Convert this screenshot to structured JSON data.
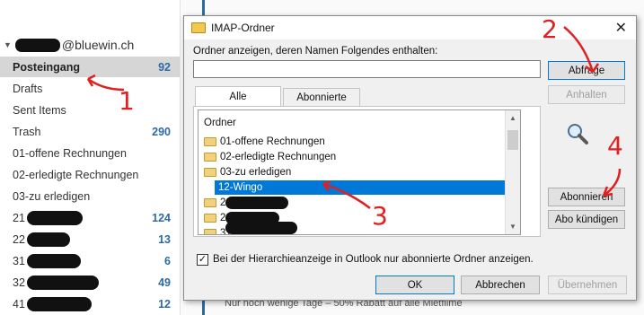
{
  "folder_pane": {
    "account_suffix": "@bluewin.ch",
    "folders": [
      {
        "label": "Posteingang",
        "count": "92",
        "selected": true
      },
      {
        "label": "Drafts",
        "count": ""
      },
      {
        "label": "Sent Items",
        "count": ""
      },
      {
        "label": "Trash",
        "count": "290"
      },
      {
        "label": "01-offene Rechnungen",
        "count": ""
      },
      {
        "label": "02-erledigte Rechnungen",
        "count": ""
      },
      {
        "label": "03-zu erledigen",
        "count": ""
      },
      {
        "label": "21",
        "count": "124"
      },
      {
        "label": "22",
        "count": "13"
      },
      {
        "label": "31",
        "count": "6"
      },
      {
        "label": "32",
        "count": "49"
      },
      {
        "label": "41",
        "count": "12"
      }
    ]
  },
  "message_list": {
    "bottom_line": "Nur noch wenige Tage – 50% Rabatt auf alle Mietfilme"
  },
  "dialog": {
    "title": "IMAP-Ordner",
    "filter_label": "Ordner anzeigen, deren Namen Folgendes enthalten:",
    "filter_value": "",
    "tabs": [
      "Alle",
      "Abonnierte"
    ],
    "tree_header": "Ordner",
    "tree_items": [
      {
        "label": "01-offene Rechnungen",
        "selected": false
      },
      {
        "label": "02-erledigte Rechnungen",
        "selected": false
      },
      {
        "label": "03-zu erledigen",
        "selected": false
      },
      {
        "label": "12-Wingo",
        "selected": true
      },
      {
        "label": "21",
        "selected": false
      },
      {
        "label": "22",
        "selected": false
      },
      {
        "label": "31",
        "selected": false
      }
    ],
    "buttons": {
      "abfrage": "Abfrage",
      "anhalten": "Anhalten",
      "abonnieren": "Abonnieren",
      "abo_kuendigen": "Abo kündigen",
      "ok": "OK",
      "abbrechen": "Abbrechen",
      "uebernehmen": "Übernehmen"
    },
    "checkbox_label": "Bei der Hierarchieanzeige in Outlook nur abonnierte Ordner anzeigen.",
    "checkbox_checked": true
  },
  "annotations": [
    "1",
    "2",
    "3",
    "4"
  ],
  "colors": {
    "annotation": "#e02020",
    "selection": "#0078d7",
    "count": "#2b6aa6"
  }
}
